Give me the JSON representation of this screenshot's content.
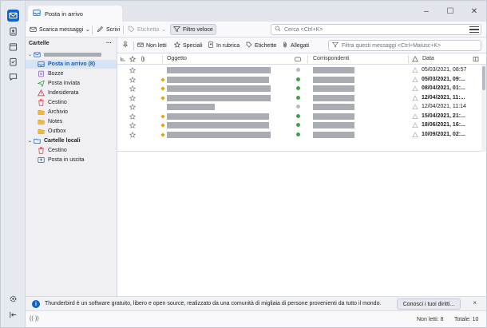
{
  "colors": {
    "accent": "#0c63cf",
    "selected_bg": "#d6e4f7",
    "star_blue": "#0c63cf",
    "junk_yellow": "#e5a50a",
    "status_green": "#3fa34d"
  },
  "titlebar": {
    "tab_label": "Posta in arrivo"
  },
  "toolbar": {
    "get_messages": "Scarica messaggi",
    "write": "Scrivi",
    "tag": "Etichetta",
    "quick_filter": "Filtro veloce",
    "search_placeholder": "Cerca <Ctrl+K>"
  },
  "folders": {
    "header": "Cartelle",
    "header_menu": "···",
    "items": [
      {
        "label": "Posta in arrivo (8)",
        "icon": "inbox-icon"
      },
      {
        "label": "Bozze",
        "icon": "drafts-icon"
      },
      {
        "label": "Posta inviata",
        "icon": "sent-icon"
      },
      {
        "label": "Indesiderata",
        "icon": "junk-icon"
      },
      {
        "label": "Cestino",
        "icon": "trash-icon"
      },
      {
        "label": "Archivio",
        "icon": "archive-icon"
      },
      {
        "label": "Notes",
        "icon": "folder-icon"
      },
      {
        "label": "Outbox",
        "icon": "folder-icon"
      }
    ],
    "local": {
      "label": "Cartelle locali",
      "items": [
        {
          "label": "Cestino",
          "icon": "trash-icon"
        },
        {
          "label": "Posta in uscita",
          "icon": "outbox-icon"
        }
      ]
    }
  },
  "quick_filter": {
    "unread": "Non letti",
    "starred": "Speciali",
    "contacts": "In rubrica",
    "tags": "Etichette",
    "attachments": "Allegati",
    "filter_placeholder": "Filtra questi messaggi <Ctrl+Maiusc+K>"
  },
  "columns": {
    "subject": "Oggetto",
    "correspondents": "Corrispondenti",
    "date": "Data"
  },
  "messages": [
    {
      "date": "05/03/2021, 08:57",
      "unread": false,
      "junk": false,
      "status": "gray"
    },
    {
      "date": "05/03/2021, 09:...",
      "unread": true,
      "junk": true,
      "status": "green"
    },
    {
      "date": "08/04/2021, 01:...",
      "unread": true,
      "junk": true,
      "status": "green"
    },
    {
      "date": "12/04/2021, 11:...",
      "unread": true,
      "junk": true,
      "status": "green"
    },
    {
      "date": "12/04/2021, 11:14",
      "unread": false,
      "junk": false,
      "status": "gray"
    },
    {
      "date": "15/04/2021, 21:...",
      "unread": true,
      "junk": true,
      "status": "green"
    },
    {
      "date": "18/06/2021, 16:...",
      "unread": true,
      "junk": true,
      "status": "green"
    },
    {
      "date": "10/09/2021, 02:...",
      "unread": true,
      "junk": true,
      "status": "green"
    }
  ],
  "notification": {
    "text": "Thunderbird è un software gratuito, libero e open source, realizzato da una comunità di migliaia di persone provenienti da tutto il mondo.",
    "button": "Conosci i tuoi diritti...",
    "close": "×"
  },
  "status": {
    "unread": "Non letti: 8",
    "total": "Totale: 10",
    "activity": "((·))"
  }
}
